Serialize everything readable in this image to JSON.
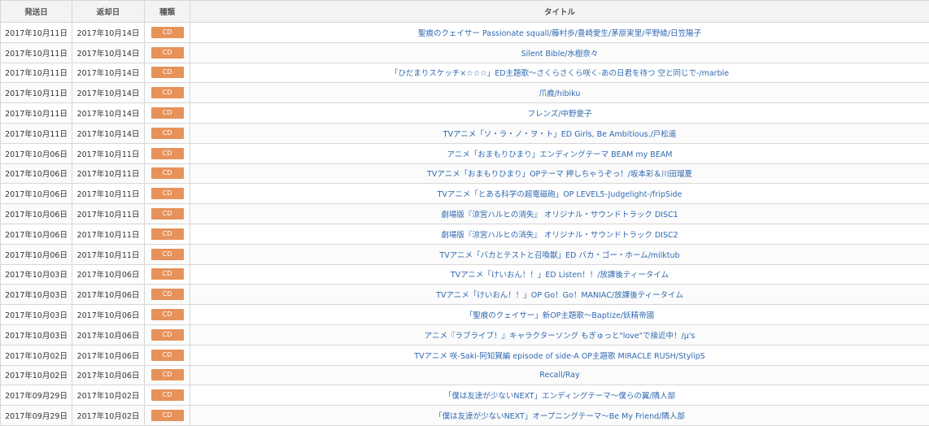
{
  "table": {
    "headers": {
      "send_date": "発送日",
      "return_date": "返却日",
      "type": "種類",
      "title": "タイトル"
    },
    "rows": [
      {
        "send": "2017年10月11日",
        "ret": "2017年10月14日",
        "type": "CD",
        "title": "聖痕のクェイサー Passionate squall/藤村歩/豊崎愛生/茅原実里/平野綾/日笠陽子"
      },
      {
        "send": "2017年10月11日",
        "ret": "2017年10月14日",
        "type": "CD",
        "title": "Silent Bible/水樹奈々"
      },
      {
        "send": "2017年10月11日",
        "ret": "2017年10月14日",
        "type": "CD",
        "title": "「ひだまりスケッチ×☆☆☆」ED主題歌〜さくらさくら咲く-あの日君を待つ 空と同じで-/marble"
      },
      {
        "send": "2017年10月11日",
        "ret": "2017年10月14日",
        "type": "CD",
        "title": "爪痕/hibiku"
      },
      {
        "send": "2017年10月11日",
        "ret": "2017年10月14日",
        "type": "CD",
        "title": "フレンズ/中野愛子"
      },
      {
        "send": "2017年10月11日",
        "ret": "2017年10月14日",
        "type": "CD",
        "title": "TVアニメ「ソ・ラ・ノ・ヲ・ト」ED Girls, Be Ambitious./戸松遥"
      },
      {
        "send": "2017年10月06日",
        "ret": "2017年10月11日",
        "type": "CD",
        "title": "アニメ「おまもりひまり」エンディングテーマ BEAM my BEAM"
      },
      {
        "send": "2017年10月06日",
        "ret": "2017年10月11日",
        "type": "CD",
        "title": "TVアニメ「おまもりひまり」OPテーマ 押しちゃうぞっ！/坂本彩＆川田瑠夏"
      },
      {
        "send": "2017年10月06日",
        "ret": "2017年10月11日",
        "type": "CD",
        "title": "TVアニメ「とある科学の超電磁砲」OP LEVEL5-Judgelight-/fripSide"
      },
      {
        "send": "2017年10月06日",
        "ret": "2017年10月11日",
        "type": "CD",
        "title": "劇場版『涼宮ハルヒの消失』 オリジナル・サウンドトラック DISC1"
      },
      {
        "send": "2017年10月06日",
        "ret": "2017年10月11日",
        "type": "CD",
        "title": "劇場版『涼宮ハルヒの消失』 オリジナル・サウンドトラック DISC2"
      },
      {
        "send": "2017年10月06日",
        "ret": "2017年10月11日",
        "type": "CD",
        "title": "TVアニメ「バカとテストと召喚獣」ED バカ・ゴー・ホーム/milktub"
      },
      {
        "send": "2017年10月03日",
        "ret": "2017年10月06日",
        "type": "CD",
        "title": "TVアニメ「けいおん！！」ED Listen！！/放課後ティータイム"
      },
      {
        "send": "2017年10月03日",
        "ret": "2017年10月06日",
        "type": "CD",
        "title": "TVアニメ「けいおん！！」OP Go！Go！MANIAC/放課後ティータイム"
      },
      {
        "send": "2017年10月03日",
        "ret": "2017年10月06日",
        "type": "CD",
        "title": "「聖痕のクェイサー」新OP主題歌〜Baptize/妖精帝國"
      },
      {
        "send": "2017年10月03日",
        "ret": "2017年10月06日",
        "type": "CD",
        "title": "アニメ『ラブライブ！』キャラクターソング もぎゅっと\"love\"で接近中！/μ's"
      },
      {
        "send": "2017年10月02日",
        "ret": "2017年10月06日",
        "type": "CD",
        "title": "TVアニメ 咲-Saki-阿知賀編 episode of side-A OP主題歌 MIRACLE RUSH/StylipS"
      },
      {
        "send": "2017年10月02日",
        "ret": "2017年10月06日",
        "type": "CD",
        "title": "Recall/Ray"
      },
      {
        "send": "2017年09月29日",
        "ret": "2017年10月02日",
        "type": "CD",
        "title": "「僕は友達が少ないNEXT」エンディングテーマ〜僕らの翼/隣人部"
      },
      {
        "send": "2017年09月29日",
        "ret": "2017年10月02日",
        "type": "CD",
        "title": "「僕は友達が少ないNEXT」オープニングテーマ〜Be My Friend/隣人部"
      }
    ]
  },
  "colors": {
    "badge": "#e6925a",
    "link": "#2f68b0",
    "header_bg": "#f3f3f3",
    "border": "#d7d7d7"
  }
}
